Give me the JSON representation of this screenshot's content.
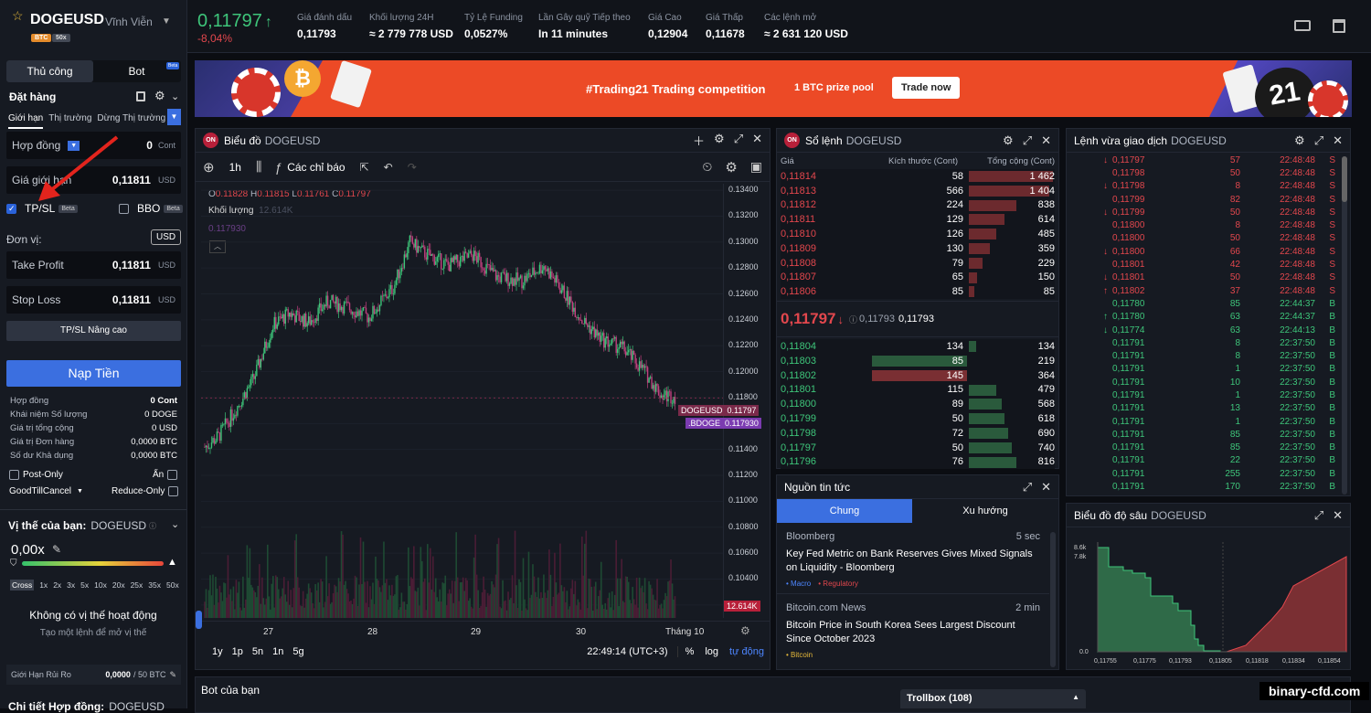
{
  "header": {
    "symbol": "DOGEUSD",
    "contract_type": "Vĩnh Viễn",
    "badge_coin": "BTC",
    "badge_leverage": "50x",
    "last_price": "0,11797",
    "last_arrow": "↑",
    "change_pct": "-8,04%",
    "stats": [
      {
        "label": "Giá đánh dấu",
        "value": "0,11793"
      },
      {
        "label": "Khối lượng 24H",
        "value": "≈ 2 779 778 USD"
      },
      {
        "label": "Tỷ Lệ Funding",
        "value": "0,0527%"
      },
      {
        "label": "Lần Gây quỹ Tiếp theo",
        "value": "In 11 minutes"
      },
      {
        "label": "Giá Cao",
        "value": "0,12904"
      },
      {
        "label": "Giá Thấp",
        "value": "0,11678"
      },
      {
        "label": "Các lệnh mở",
        "value": "≈ 2 631 120 USD"
      }
    ]
  },
  "banner": {
    "title": "#Trading21 Trading competition",
    "prize": "1 BTC prize pool",
    "cta": "Trade now",
    "logo": "21"
  },
  "order": {
    "tabs": [
      "Thủ công",
      "Bot"
    ],
    "bot_badge": "Beta",
    "title": "Đặt hàng",
    "type_tabs": [
      "Giới hạn",
      "Thị trường",
      "Dừng Thị trường"
    ],
    "contract_label": "Hợp đồng",
    "contract_value": "0",
    "contract_unit": "Cont",
    "limit_price_label": "Giá giới hạn",
    "limit_price_value": "0,11811",
    "limit_price_unit": "USD",
    "tpsl_label": "TP/SL",
    "tpsl_beta": "Beta",
    "bbo_label": "BBO",
    "bbo_beta": "Beta",
    "unit_label": "Đơn vị:",
    "unit_value": "USD",
    "tp_label": "Take Profit",
    "tp_value": "0,11811",
    "tp_unit": "USD",
    "sl_label": "Stop Loss",
    "sl_value": "0,11811",
    "sl_unit": "USD",
    "advanced": "TP/SL Nâng cao",
    "deposit": "Nạp Tiền",
    "summary": [
      {
        "label": "Hợp đồng",
        "value": "0 Cont"
      },
      {
        "label": "Khái niệm Số lượng",
        "value": "0 DOGE"
      },
      {
        "label": "Giá trị tổng cộng",
        "value": "0 USD"
      },
      {
        "label": "Giá trị Đơn hàng",
        "value": "0,0000 BTC"
      },
      {
        "label": "Số dư Khả dụng",
        "value": "0,0000 BTC"
      }
    ],
    "post_only": "Post-Only",
    "hidden": "Ẩn",
    "tif": "GoodTillCancel",
    "reduce_only": "Reduce-Only",
    "position_title": "Vị thế của bạn:",
    "position_symbol": "DOGEUSD",
    "leverage": "0,00x",
    "lev_marks": [
      "Cross",
      "1x",
      "2x",
      "3x",
      "5x",
      "10x",
      "20x",
      "25x",
      "35x",
      "50x"
    ],
    "no_position": "Không có vị thế hoạt động",
    "no_position_hint": "Tạo một lệnh để mở vị thế",
    "risk_label": "Giới Hạn Rủi Ro",
    "risk_value": "0,0000",
    "risk_max": "/ 50 BTC",
    "details_label": "Chi tiết Hợp đồng:",
    "details_symbol": "DOGEUSD"
  },
  "chart": {
    "panel_title": "Biểu đồ",
    "symbol": "DOGEUSD",
    "on_badge": "ON",
    "interval": "1h",
    "indicators": "Các chỉ báo",
    "ohlc": {
      "o": "0.11828",
      "h": "0.11815",
      "l": "0.11761",
      "c": "0.11797"
    },
    "volume_label": "Khối lượng",
    "volume_value": "12.614K",
    "mark_value": "0.117930",
    "price_tag_1_name": "DOGEUSD",
    "price_tag_1_value": "0.11797",
    "price_tag_2_name": ".BDOGE",
    "price_tag_2_value": "0.117930",
    "volume_tag": "12.614K",
    "y_ticks": [
      "0.13400",
      "0.13200",
      "0.13000",
      "0.12800",
      "0.12600",
      "0.12400",
      "0.12200",
      "0.12000",
      "0.11800",
      "0.11600",
      "0.11400",
      "0.11200",
      "0.11000",
      "0.10800",
      "0.10600",
      "0.10400",
      "0.10200"
    ],
    "x_ticks": [
      "27",
      "28",
      "29",
      "30",
      "Tháng 10"
    ],
    "ranges": [
      "1y",
      "1p",
      "5n",
      "1n",
      "5g"
    ],
    "clock": "22:49:14 (UTC+3)",
    "pct": "%",
    "log": "log",
    "auto": "tự động",
    "colors": {
      "up": "#3ec57a",
      "down": "#c2407f"
    }
  },
  "orderbook": {
    "panel_title": "Sổ lệnh",
    "symbol": "DOGEUSD",
    "on_badge": "ON",
    "headers": [
      "Giá",
      "Kích thước (Cont)",
      "Tổng cộng (Cont)"
    ],
    "asks": [
      {
        "p": "0,11814",
        "s": "58",
        "t": "1 462",
        "d": 1.0
      },
      {
        "p": "0,11813",
        "s": "566",
        "t": "1 404",
        "d": 0.96
      },
      {
        "p": "0,11812",
        "s": "224",
        "t": "838",
        "d": 0.57
      },
      {
        "p": "0,11811",
        "s": "129",
        "t": "614",
        "d": 0.42
      },
      {
        "p": "0,11810",
        "s": "126",
        "t": "485",
        "d": 0.33
      },
      {
        "p": "0,11809",
        "s": "130",
        "t": "359",
        "d": 0.25
      },
      {
        "p": "0,11808",
        "s": "79",
        "t": "229",
        "d": 0.16
      },
      {
        "p": "0,11807",
        "s": "65",
        "t": "150",
        "d": 0.1
      },
      {
        "p": "0,11806",
        "s": "85",
        "t": "85",
        "d": 0.06
      }
    ],
    "mid_price": "0,11797",
    "mid_arrow": "↓",
    "mark": "0,11793",
    "index": "0,11793",
    "bids": [
      {
        "p": "0,11804",
        "s": "134",
        "t": "134",
        "d": 0.09
      },
      {
        "p": "0,11803",
        "s": "85",
        "t": "219",
        "d": 0.15
      },
      {
        "p": "0,11802",
        "s": "145",
        "t": "364",
        "d": 0.25
      },
      {
        "p": "0,11801",
        "s": "115",
        "t": "479",
        "d": 0.33
      },
      {
        "p": "0,11800",
        "s": "89",
        "t": "568",
        "d": 0.39
      },
      {
        "p": "0,11799",
        "s": "50",
        "t": "618",
        "d": 0.42
      },
      {
        "p": "0,11798",
        "s": "72",
        "t": "690",
        "d": 0.47
      },
      {
        "p": "0,11797",
        "s": "50",
        "t": "740",
        "d": 0.51
      },
      {
        "p": "0,11796",
        "s": "76",
        "t": "816",
        "d": 0.56
      }
    ]
  },
  "news": {
    "panel_title": "Nguồn tin tức",
    "tabs": [
      "Chung",
      "Xu hướng"
    ],
    "items": [
      {
        "source": "Bloomberg",
        "time": "5 sec",
        "title": "Key Fed Metric on Bank Reserves Gives Mixed Signals on Liquidity - Bloomberg",
        "tags": [
          "Macro",
          "Regulatory"
        ]
      },
      {
        "source": "Bitcoin.com News",
        "time": "2 min",
        "title": "Bitcoin Price in South Korea Sees Largest Discount Since October 2023",
        "tags": [
          "Bitcoin"
        ]
      }
    ]
  },
  "trades": {
    "panel_title": "Lệnh vừa giao dịch",
    "symbol": "DOGEUSD",
    "rows": [
      {
        "a": "down",
        "p": "0,11797",
        "q": "57",
        "t": "22:48:48",
        "s": "S"
      },
      {
        "a": "",
        "p": "0,11798",
        "q": "50",
        "t": "22:48:48",
        "s": "S"
      },
      {
        "a": "down",
        "p": "0,11798",
        "q": "8",
        "t": "22:48:48",
        "s": "S"
      },
      {
        "a": "",
        "p": "0,11799",
        "q": "82",
        "t": "22:48:48",
        "s": "S"
      },
      {
        "a": "down",
        "p": "0,11799",
        "q": "50",
        "t": "22:48:48",
        "s": "S"
      },
      {
        "a": "",
        "p": "0,11800",
        "q": "8",
        "t": "22:48:48",
        "s": "S"
      },
      {
        "a": "",
        "p": "0,11800",
        "q": "50",
        "t": "22:48:48",
        "s": "S"
      },
      {
        "a": "down",
        "p": "0,11800",
        "q": "66",
        "t": "22:48:48",
        "s": "S"
      },
      {
        "a": "",
        "p": "0,11801",
        "q": "42",
        "t": "22:48:48",
        "s": "S"
      },
      {
        "a": "down",
        "p": "0,11801",
        "q": "50",
        "t": "22:48:48",
        "s": "S"
      },
      {
        "a": "up",
        "p": "0,11802",
        "q": "37",
        "t": "22:48:48",
        "s": "S"
      },
      {
        "a": "",
        "p": "0,11780",
        "q": "85",
        "t": "22:44:37",
        "s": "B"
      },
      {
        "a": "up",
        "p": "0,11780",
        "q": "63",
        "t": "22:44:37",
        "s": "B"
      },
      {
        "a": "down",
        "p": "0,11774",
        "q": "63",
        "t": "22:44:13",
        "s": "B"
      },
      {
        "a": "",
        "p": "0,11791",
        "q": "8",
        "t": "22:37:50",
        "s": "B"
      },
      {
        "a": "",
        "p": "0,11791",
        "q": "8",
        "t": "22:37:50",
        "s": "B"
      },
      {
        "a": "",
        "p": "0,11791",
        "q": "1",
        "t": "22:37:50",
        "s": "B"
      },
      {
        "a": "",
        "p": "0,11791",
        "q": "10",
        "t": "22:37:50",
        "s": "B"
      },
      {
        "a": "",
        "p": "0,11791",
        "q": "1",
        "t": "22:37:50",
        "s": "B"
      },
      {
        "a": "",
        "p": "0,11791",
        "q": "13",
        "t": "22:37:50",
        "s": "B"
      },
      {
        "a": "",
        "p": "0,11791",
        "q": "1",
        "t": "22:37:50",
        "s": "B"
      },
      {
        "a": "",
        "p": "0,11791",
        "q": "85",
        "t": "22:37:50",
        "s": "B"
      },
      {
        "a": "",
        "p": "0,11791",
        "q": "85",
        "t": "22:37:50",
        "s": "B"
      },
      {
        "a": "",
        "p": "0,11791",
        "q": "22",
        "t": "22:37:50",
        "s": "B"
      },
      {
        "a": "",
        "p": "0,11791",
        "q": "255",
        "t": "22:37:50",
        "s": "B"
      },
      {
        "a": "",
        "p": "0,11791",
        "q": "170",
        "t": "22:37:50",
        "s": "B"
      }
    ]
  },
  "depth": {
    "panel_title": "Biểu đồ độ sâu",
    "symbol": "DOGEUSD",
    "y_ticks": [
      "8.6k",
      "7.8k",
      "0.0"
    ],
    "x_ticks": [
      "0,11755",
      "0,11775",
      "0,11793",
      "0,11805",
      "0,11818",
      "0,11834",
      "0,11854"
    ]
  },
  "bottom": {
    "bots_title": "Bot của bạn",
    "trollbox": "Trollbox (108)",
    "watermark": "binary-cfd.com"
  },
  "chart_data": {
    "type": "candlestick",
    "x_ticks": [
      "27",
      "28",
      "29",
      "30",
      "Tháng 10"
    ],
    "ylim": [
      0.101,
      0.1345
    ],
    "last": 0.11797
  }
}
